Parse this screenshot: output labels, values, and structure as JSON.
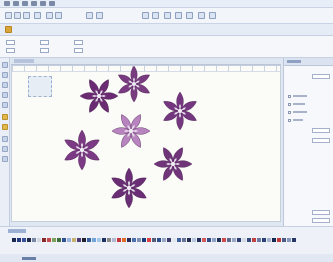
{
  "window": {
    "title": ""
  },
  "toolbar": {
    "icons": [
      "new-icon",
      "open-icon",
      "save-icon",
      "print-icon",
      "undo-icon",
      "redo-icon",
      "zoom-icon",
      "select-icon",
      "stitch-icon",
      "color-icon"
    ]
  },
  "design": {
    "flowers": [
      {
        "name": "flower-top",
        "color": "#7a3c80"
      },
      {
        "name": "flower-upper-left",
        "color": "#6a2b72"
      },
      {
        "name": "flower-upper-right",
        "color": "#74367e"
      },
      {
        "name": "flower-center",
        "color": "#b884bf"
      },
      {
        "name": "flower-left",
        "color": "#7d3a84"
      },
      {
        "name": "flower-right",
        "color": "#6f3578"
      },
      {
        "name": "flower-bottom",
        "color": "#6a2e74"
      }
    ]
  },
  "palette": {
    "colors": [
      "#1b2a55",
      "#253a7c",
      "#3a4f9a",
      "#1f2a48",
      "#7a86a6",
      "#d2d7e3",
      "#8a2a2a",
      "#c24c4c",
      "#7da05a",
      "#3f6f3a",
      "#2f4f94",
      "#9bb0da",
      "#c8b070",
      "#4d3a73",
      "#1f1f2f",
      "#3a5fa0",
      "#6fa4d6",
      "#a7c7e7",
      "#203060",
      "#8a8a8a",
      "#b0b9cf",
      "#c23838",
      "#e06a2a",
      "#2a2a5a",
      "#4a70b0",
      "#7f8fb4",
      "#1a3c7e",
      "#d84040",
      "#555d7a",
      "#2b4f8f",
      "#99a5c2",
      "#3c3c6c",
      "#e2e6ef",
      "#41609f",
      "#6a7598",
      "#232f4f",
      "#b8c4dd",
      "#1f2e5c",
      "#d35a5a",
      "#314b88",
      "#8fa0c5",
      "#22305a",
      "#cf4c4c",
      "#5e6a8c",
      "#9aa7c4",
      "#2a3b73",
      "#d1d8e8",
      "#374a80",
      "#c14343",
      "#6b7a9e",
      "#2d4078",
      "#a3b0cc",
      "#1a2750",
      "#bd3b3b",
      "#4b5b85",
      "#8595bb",
      "#273868"
    ]
  },
  "rpanel": {
    "fields": [
      "",
      "",
      "",
      "",
      ""
    ]
  }
}
